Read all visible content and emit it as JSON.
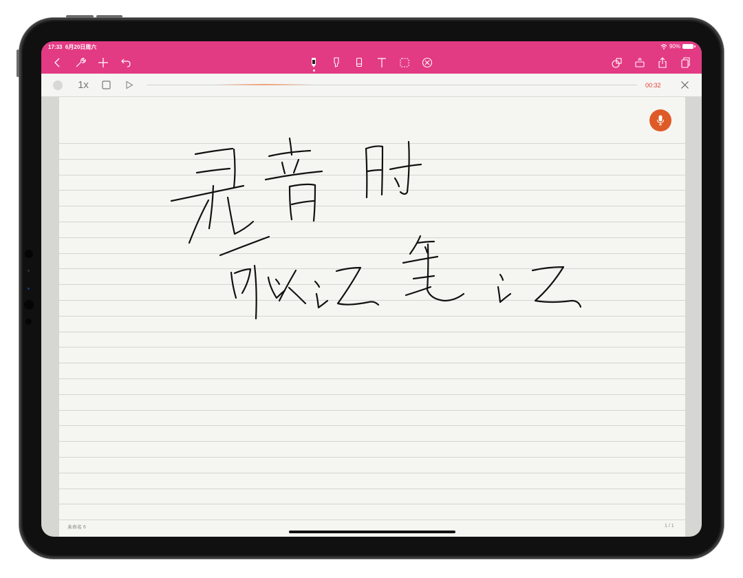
{
  "status": {
    "time": "17:33",
    "date": "6月20日周六",
    "battery_pct": "90%"
  },
  "toolbar": {
    "left_icons": [
      "back-icon",
      "wrench-icon",
      "plus-icon",
      "undo-icon"
    ],
    "center_icons": [
      "pen-icon",
      "highlighter-icon",
      "eraser-icon",
      "text-icon",
      "lasso-icon",
      "cancel-icon"
    ],
    "right_icons": [
      "shapes-icon",
      "sticker-icon",
      "share-icon",
      "pages-icon"
    ],
    "accent": "#e33a84"
  },
  "audio": {
    "speed": "1x",
    "elapsed": "00:32",
    "timer_color": "#e3402f"
  },
  "note": {
    "handwriting_lines": [
      "录音时",
      "可以记笔记"
    ],
    "title": "未命名 6",
    "page_number": "1 / 1",
    "mic_color": "#de5a27"
  }
}
